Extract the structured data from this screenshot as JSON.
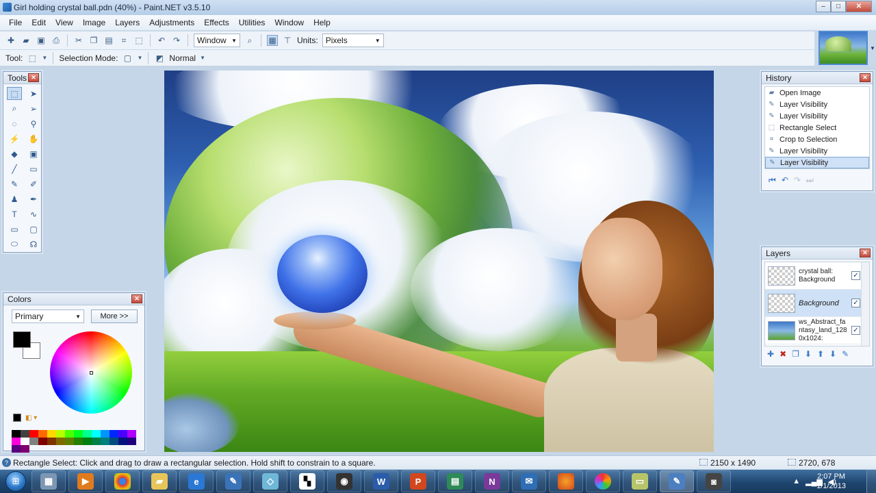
{
  "window": {
    "title": "Girl holding crystal ball.pdn (40%) - Paint.NET v3.5.10",
    "buttons": {
      "minimize": "–",
      "maximize": "□",
      "close": "✕"
    }
  },
  "menu": [
    "File",
    "Edit",
    "View",
    "Image",
    "Layers",
    "Adjustments",
    "Effects",
    "Utilities",
    "Window",
    "Help"
  ],
  "toolbar": {
    "zoom_value": "Window",
    "units_label": "Units:",
    "units_value": "Pixels",
    "tool_label": "Tool:",
    "selection_mode_label": "Selection Mode:",
    "blend_mode": "Normal"
  },
  "tools_panel": {
    "title": "Tools",
    "icons": [
      "rectangle-select-icon",
      "move-selection-icon",
      "lasso-icon",
      "move-pixels-icon",
      "ellipse-select-icon",
      "zoom-icon",
      "magic-wand-icon",
      "pan-icon",
      "paint-bucket-icon",
      "gradient-icon",
      "paintbrush-icon",
      "eraser-icon",
      "pencil-icon",
      "color-picker-icon",
      "clone-stamp-icon",
      "recolor-icon",
      "text-icon",
      "line-curve-icon",
      "rectangle-icon",
      "rounded-rectangle-icon",
      "ellipse-icon",
      "freeform-shape-icon"
    ]
  },
  "history_panel": {
    "title": "History",
    "items": [
      "Open Image",
      "Layer Visibility",
      "Layer Visibility",
      "Rectangle Select",
      "Crop to Selection",
      "Layer Visibility",
      "Layer Visibility"
    ],
    "selected_index": 6
  },
  "layers_panel": {
    "title": "Layers",
    "layers": [
      {
        "name": "crystal ball: Background",
        "visible": true
      },
      {
        "name": "Background",
        "visible": true
      },
      {
        "name": "ws_Abstract_fantasy_land_1280x1024:",
        "visible": true
      }
    ],
    "selected_index": 1
  },
  "colors_panel": {
    "title": "Colors",
    "mode": "Primary",
    "more_button": "More >>",
    "primary_color": "#000000",
    "secondary_color": "#ffffff",
    "palette": [
      "#000000",
      "#404040",
      "#ff0000",
      "#ff6a00",
      "#ffd800",
      "#b6ff00",
      "#4cff00",
      "#00ff21",
      "#00ff90",
      "#00ffff",
      "#0094ff",
      "#0026ff",
      "#4800ff",
      "#b200ff",
      "#ff00dc",
      "#ffffff",
      "#808080",
      "#7f0000",
      "#7f3300",
      "#7f6a00",
      "#5b7f00",
      "#267f00",
      "#007f0e",
      "#007f46",
      "#007f7f",
      "#004a7f",
      "#00137f",
      "#21007f",
      "#57007f",
      "#7f006e"
    ]
  },
  "status": {
    "message": "Rectangle Select: Click and drag to draw a rectangular selection. Hold shift to constrain to a square.",
    "image_size": "2150 x 1490",
    "cursor_position": "2720, 678"
  },
  "taskbar": {
    "apps": [
      "calculator-icon",
      "media-player-icon",
      "chrome-icon",
      "explorer-folder-icon",
      "internet-explorer-icon",
      "notepad-icon",
      "glass-app-icon",
      "paint-net-icon",
      "camera-icon",
      "word-icon",
      "powerpoint-icon",
      "publisher-icon",
      "onenote-icon",
      "outlook-icon",
      "firefox-icon",
      "picasa-icon",
      "notes-icon",
      "paintnet-running-icon",
      "video-camera-icon"
    ],
    "time": "2:07 PM",
    "date": "1/1/2013"
  }
}
